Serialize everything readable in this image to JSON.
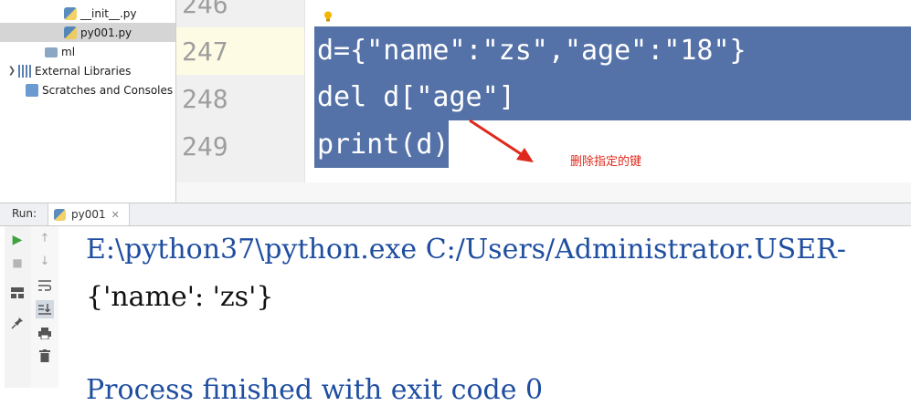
{
  "project_tree": {
    "items": [
      {
        "label": "__init__.py"
      },
      {
        "label": "py001.py"
      },
      {
        "label": "ml"
      },
      {
        "label": "External Libraries"
      },
      {
        "label": "Scratches and Consoles"
      }
    ]
  },
  "editor": {
    "line_numbers": [
      "246",
      "247",
      "248",
      "249"
    ],
    "code_lines": [
      "d={\"name\":\"zs\",\"age\":\"18\"}",
      "del d[\"age\"]",
      "print(d)"
    ],
    "annotation": "删除指定的键",
    "selection_color": "#5572a8",
    "annotation_color": "#e0281c"
  },
  "run_panel": {
    "label": "Run:",
    "tab_label": "py001",
    "console_lines": [
      "E:\\python37\\python.exe C:/Users/Administrator.USER-",
      "{'name': 'zs'}",
      "",
      "Process finished with exit code 0"
    ]
  }
}
